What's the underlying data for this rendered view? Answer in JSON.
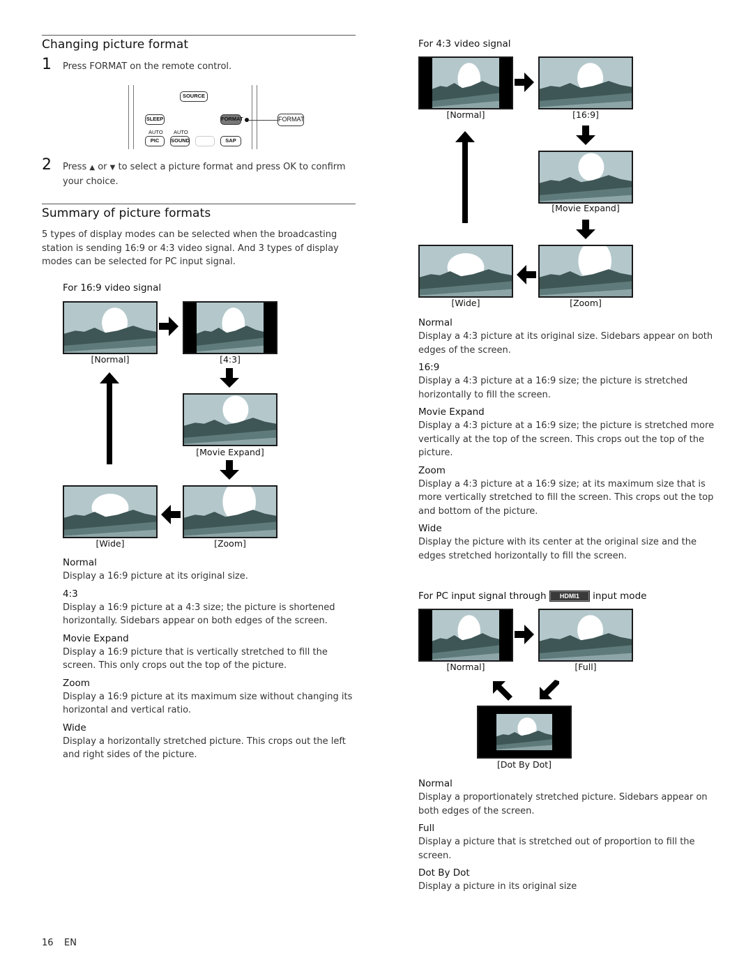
{
  "page": {
    "number": "16",
    "lang": "EN"
  },
  "colors": {
    "sky": "#b4c8cc",
    "mountain": "#3e5655",
    "band_mid": "#5f7a7a",
    "band_low": "#8ea5a8",
    "sun": "#ffffff",
    "bars": "#000000"
  },
  "changing": {
    "title": "Changing picture format",
    "steps": [
      {
        "num": "1",
        "text": "Press FORMAT on the remote control."
      },
      {
        "num": "2",
        "text_before": "Press",
        "up_icon": "▲",
        "or": "or",
        "down_icon": "▼",
        "text_after": "to select a picture format and press OK to confirm your choice."
      }
    ],
    "remote": {
      "source": "SOURCE",
      "sleep": "SLEEP",
      "format": "FORMAT",
      "format_callout": "FORMAT",
      "auto1": "AUTO",
      "auto2": "AUTO",
      "pic": "PIC",
      "sound": "SOUND",
      "sap": "SAP"
    }
  },
  "summary": {
    "title": "Summary of picture formats",
    "intro": "5 types of display modes can be selected when the broadcasting station is sending 16:9 or 4:3 video signal. And 3 types of display modes can be selected for PC input signal."
  },
  "signal169": {
    "heading": "For 16:9 video signal",
    "captions": {
      "normal": "[Normal]",
      "r43": "[4:3]",
      "movie": "[Movie Expand]",
      "wide": "[Wide]",
      "zoom": "[Zoom]"
    },
    "items": [
      {
        "term": "Normal",
        "desc": "Display a 16:9 picture at its original size."
      },
      {
        "term": "4:3",
        "desc": "Display a 16:9 picture at a 4:3 size; the picture is shortened horizontally. Sidebars appear on both edges of the screen."
      },
      {
        "term": "Movie Expand",
        "desc": "Display a 16:9 picture that is vertically stretched to fill the screen. This only crops out the top of the picture."
      },
      {
        "term": "Zoom",
        "desc": "Display a 16:9 picture at its maximum size without changing its horizontal and vertical ratio."
      },
      {
        "term": "Wide",
        "desc": "Display a horizontally stretched picture. This crops out the left and right sides of the picture."
      }
    ]
  },
  "signal43": {
    "heading": "For 4:3 video signal",
    "captions": {
      "normal": "[Normal]",
      "r169": "[16:9]",
      "movie": "[Movie Expand]",
      "wide": "[Wide]",
      "zoom": "[Zoom]"
    },
    "items": [
      {
        "term": "Normal",
        "desc": "Display a 4:3 picture at its original size. Sidebars appear on both edges of the screen."
      },
      {
        "term": "16:9",
        "desc": "Display a 4:3 picture at a 16:9 size; the picture is stretched horizontally to fill the screen."
      },
      {
        "term": "Movie Expand",
        "desc": "Display a 4:3 picture at a 16:9 size; the picture is stretched more vertically at the top of the screen. This crops out the top of the picture."
      },
      {
        "term": "Zoom",
        "desc": "Display a 4:3 picture at a 16:9 size; at its maximum size that is more vertically stretched to fill the screen. This crops out the top and bottom of the picture."
      },
      {
        "term": "Wide",
        "desc": "Display the picture with its center at the original size and the edges stretched horizontally to fill the screen."
      }
    ]
  },
  "pc": {
    "heading_before": "For PC input signal through",
    "hdmi_label": "HDMI1",
    "heading_after": "input mode",
    "captions": {
      "normal": "[Normal]",
      "full": "[Full]",
      "dot": "[Dot By Dot]"
    },
    "items": [
      {
        "term": "Normal",
        "desc": "Display a proportionately stretched picture. Sidebars appear on both edges of the screen."
      },
      {
        "term": "Full",
        "desc": "Display a picture that is stretched out of proportion to fill the screen."
      },
      {
        "term": "Dot By Dot",
        "desc": "Display a picture in its original size"
      }
    ]
  }
}
